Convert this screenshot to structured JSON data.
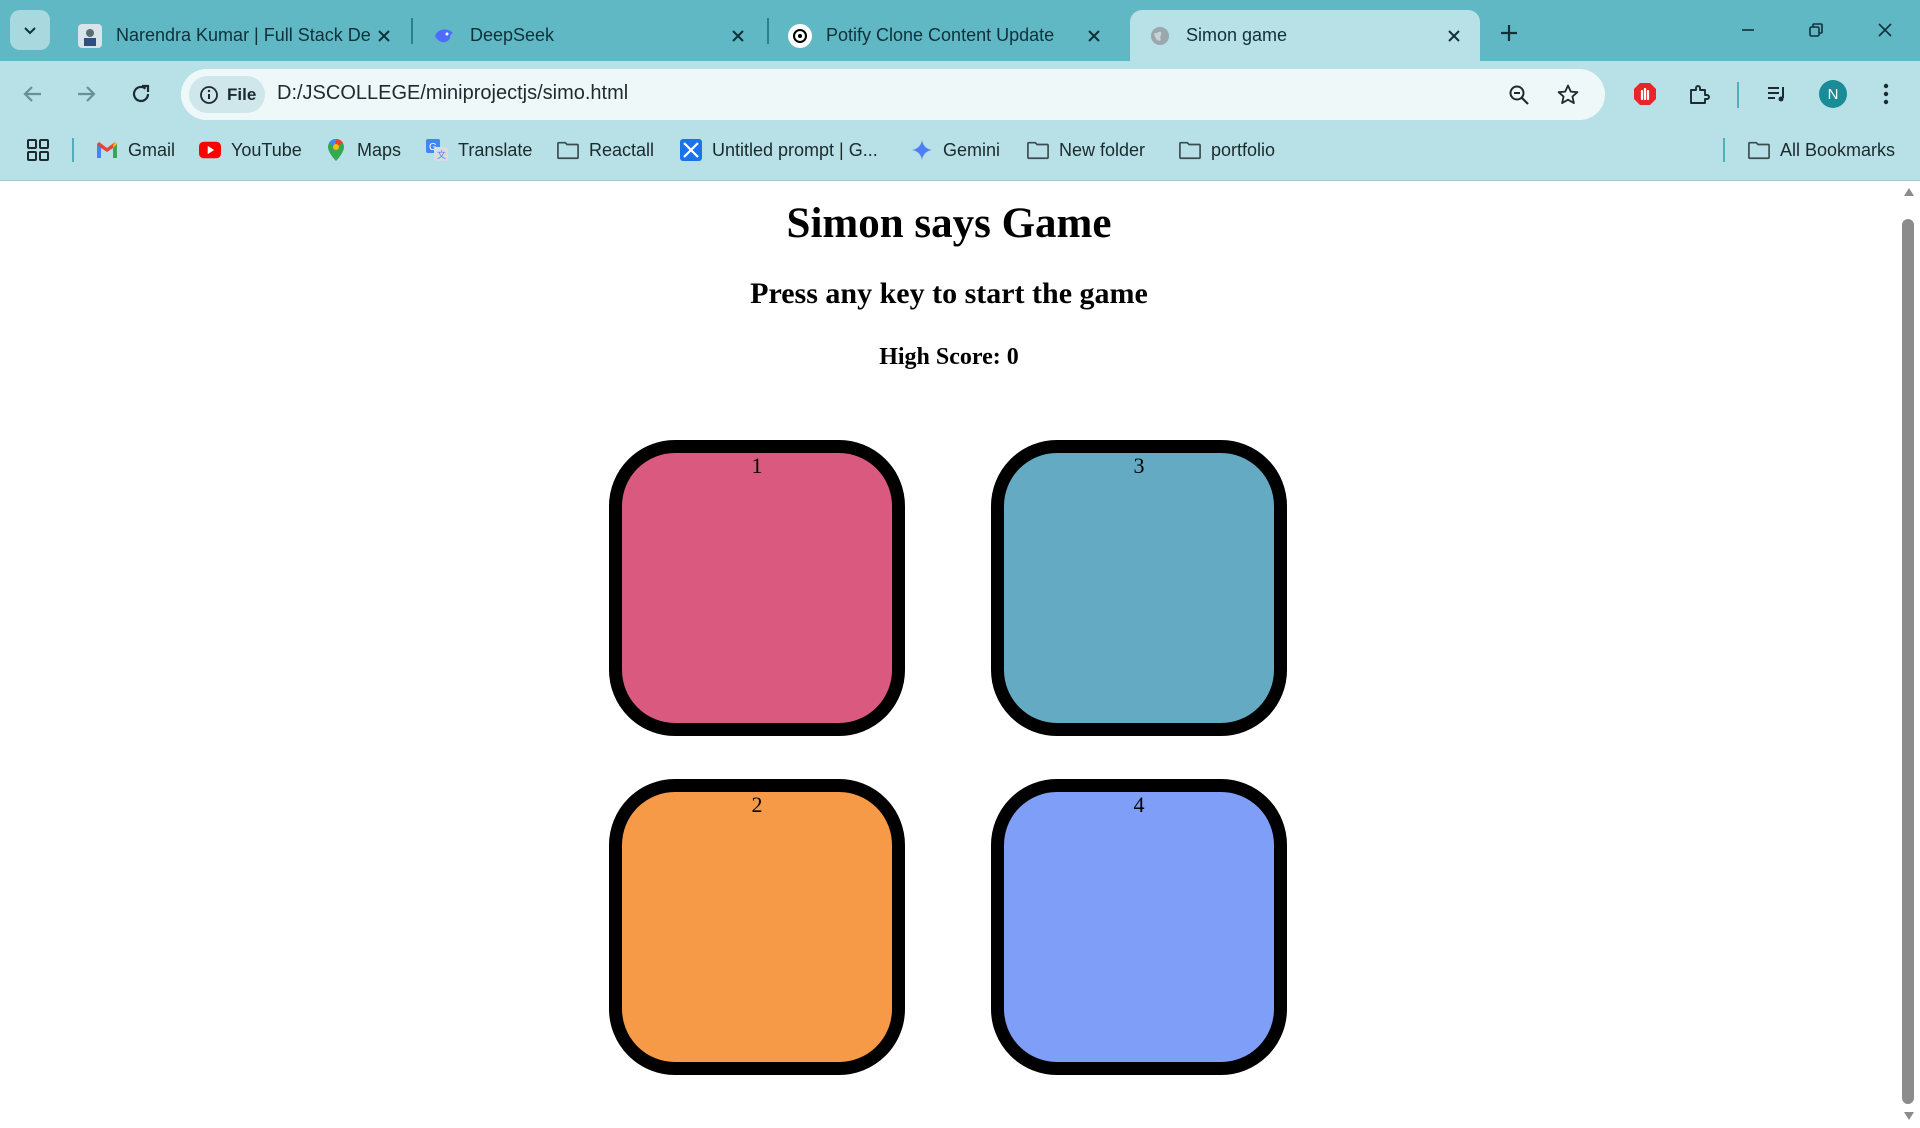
{
  "tabs": [
    {
      "title": "Narendra Kumar | Full Stack Dev",
      "favicon": "profile-photo-icon"
    },
    {
      "title": "DeepSeek",
      "favicon": "deepseek-whale-icon"
    },
    {
      "title": "Potify Clone Content Update",
      "favicon": "chatgpt-icon"
    },
    {
      "title": "Simon game",
      "favicon": "globe-icon",
      "active": true
    }
  ],
  "omnibox": {
    "chip_label": "File",
    "url": "D:/JSCOLLEGE/miniprojectjs/simo.html"
  },
  "profile": {
    "initial": "N"
  },
  "bookmarks": [
    {
      "label": "Gmail",
      "icon": "gmail-icon"
    },
    {
      "label": "YouTube",
      "icon": "youtube-icon"
    },
    {
      "label": "Maps",
      "icon": "maps-icon"
    },
    {
      "label": "Translate",
      "icon": "translate-icon"
    },
    {
      "label": "Reactall",
      "icon": "folder-icon"
    },
    {
      "label": "Untitled prompt | G...",
      "icon": "aistudio-icon"
    },
    {
      "label": "Gemini",
      "icon": "gemini-icon"
    },
    {
      "label": "New folder",
      "icon": "folder-icon"
    },
    {
      "label": "portfolio",
      "icon": "folder-icon"
    }
  ],
  "all_bookmarks_label": "All Bookmarks",
  "game": {
    "title": "Simon says Game",
    "status": "Press any key to start the game",
    "high_score": "High Score: 0",
    "buttons": [
      {
        "label": "1",
        "color": "#da5a7f"
      },
      {
        "label": "3",
        "color": "#63aac2"
      },
      {
        "label": "2",
        "color": "#f79a47"
      },
      {
        "label": "4",
        "color": "#7f9ef7"
      }
    ]
  },
  "colors": {
    "tabstrip": "#5fb8c4",
    "toolbar": "#b7e1e6"
  }
}
